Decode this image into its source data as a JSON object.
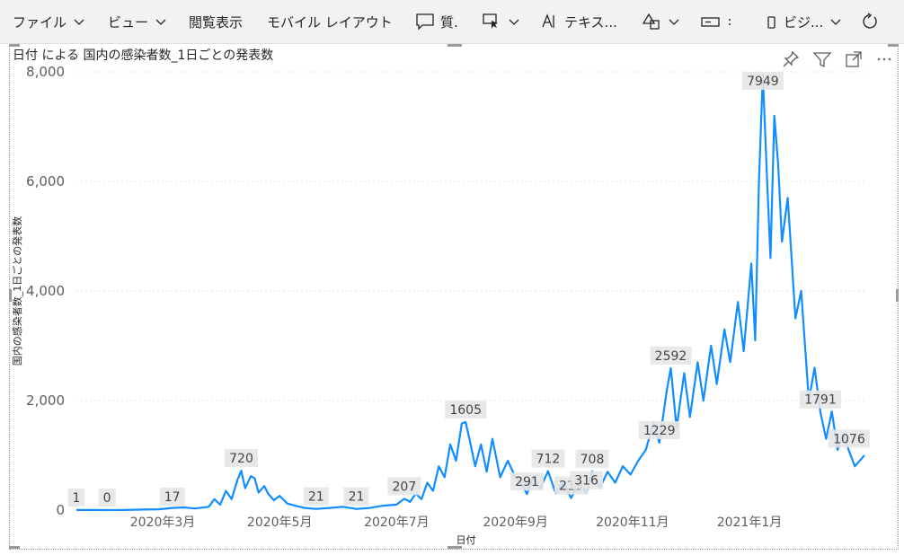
{
  "toolbar": {
    "file": "ファイル",
    "view": "ビュー",
    "reading_view": "閲覧表示",
    "mobile_layout": "モバイル レイアウト",
    "qa": "質.",
    "textbox": "テキス...",
    "visual": "ビジ..."
  },
  "chart_data": {
    "type": "line",
    "title": "日付 による 国内の感染者数_1日ごとの発表数",
    "xlabel": "日付",
    "ylabel": "国内の感染者数_1日ごとの発表数",
    "x_range": [
      "2020-01-16",
      "2021-03-02"
    ],
    "ylim": [
      0,
      8000
    ],
    "y_ticks": [
      {
        "value": 0,
        "label": "0"
      },
      {
        "value": 2000,
        "label": "2,000"
      },
      {
        "value": 4000,
        "label": "4,000"
      },
      {
        "value": 6000,
        "label": "6,000"
      },
      {
        "value": 8000,
        "label": "8,000"
      }
    ],
    "x_ticks": [
      {
        "date": "2020-03-01",
        "label": "2020年3月"
      },
      {
        "date": "2020-05-01",
        "label": "2020年5月"
      },
      {
        "date": "2020-07-01",
        "label": "2020年7月"
      },
      {
        "date": "2020-09-01",
        "label": "2020年9月"
      },
      {
        "date": "2020-11-01",
        "label": "2020年11月"
      },
      {
        "date": "2021-01-01",
        "label": "2021年1月"
      }
    ],
    "grid": true,
    "line_color": "#118dff",
    "series": [
      {
        "points": [
          [
            "2020-01-16",
            1
          ],
          [
            "2020-01-25",
            1
          ],
          [
            "2020-02-01",
            0
          ],
          [
            "2020-02-10",
            2
          ],
          [
            "2020-02-20",
            10
          ],
          [
            "2020-02-28",
            15
          ],
          [
            "2020-03-06",
            40
          ],
          [
            "2020-03-12",
            50
          ],
          [
            "2020-03-18",
            30
          ],
          [
            "2020-03-25",
            60
          ],
          [
            "2020-03-28",
            200
          ],
          [
            "2020-03-31",
            100
          ],
          [
            "2020-04-03",
            350
          ],
          [
            "2020-04-06",
            200
          ],
          [
            "2020-04-09",
            550
          ],
          [
            "2020-04-11",
            720
          ],
          [
            "2020-04-13",
            400
          ],
          [
            "2020-04-16",
            620
          ],
          [
            "2020-04-18",
            580
          ],
          [
            "2020-04-20",
            320
          ],
          [
            "2020-04-23",
            440
          ],
          [
            "2020-04-25",
            300
          ],
          [
            "2020-04-28",
            180
          ],
          [
            "2020-05-01",
            260
          ],
          [
            "2020-05-05",
            120
          ],
          [
            "2020-05-09",
            80
          ],
          [
            "2020-05-14",
            40
          ],
          [
            "2020-05-20",
            21
          ],
          [
            "2020-05-27",
            40
          ],
          [
            "2020-06-03",
            60
          ],
          [
            "2020-06-10",
            21
          ],
          [
            "2020-06-17",
            40
          ],
          [
            "2020-06-24",
            80
          ],
          [
            "2020-07-01",
            100
          ],
          [
            "2020-07-05",
            207
          ],
          [
            "2020-07-08",
            150
          ],
          [
            "2020-07-11",
            300
          ],
          [
            "2020-07-14",
            200
          ],
          [
            "2020-07-17",
            500
          ],
          [
            "2020-07-20",
            350
          ],
          [
            "2020-07-23",
            800
          ],
          [
            "2020-07-26",
            600
          ],
          [
            "2020-07-29",
            1200
          ],
          [
            "2020-08-01",
            900
          ],
          [
            "2020-08-04",
            1580
          ],
          [
            "2020-08-06",
            1605
          ],
          [
            "2020-08-08",
            1300
          ],
          [
            "2020-08-11",
            800
          ],
          [
            "2020-08-14",
            1200
          ],
          [
            "2020-08-17",
            700
          ],
          [
            "2020-08-20",
            1300
          ],
          [
            "2020-08-24",
            600
          ],
          [
            "2020-08-28",
            900
          ],
          [
            "2020-09-01",
            600
          ],
          [
            "2020-09-04",
            500
          ],
          [
            "2020-09-07",
            291
          ],
          [
            "2020-09-10",
            600
          ],
          [
            "2020-09-14",
            400
          ],
          [
            "2020-09-18",
            712
          ],
          [
            "2020-09-22",
            300
          ],
          [
            "2020-09-26",
            500
          ],
          [
            "2020-09-30",
            219
          ],
          [
            "2020-10-04",
            500
          ],
          [
            "2020-10-08",
            316
          ],
          [
            "2020-10-11",
            708
          ],
          [
            "2020-10-15",
            400
          ],
          [
            "2020-10-19",
            700
          ],
          [
            "2020-10-23",
            500
          ],
          [
            "2020-10-27",
            800
          ],
          [
            "2020-10-31",
            650
          ],
          [
            "2020-11-04",
            900
          ],
          [
            "2020-11-08",
            1100
          ],
          [
            "2020-11-12",
            1600
          ],
          [
            "2020-11-15",
            1229
          ],
          [
            "2020-11-19",
            2200
          ],
          [
            "2020-11-21",
            2592
          ],
          [
            "2020-11-24",
            1500
          ],
          [
            "2020-11-28",
            2500
          ],
          [
            "2020-12-01",
            1700
          ],
          [
            "2020-12-05",
            2700
          ],
          [
            "2020-12-08",
            2000
          ],
          [
            "2020-12-12",
            3000
          ],
          [
            "2020-12-15",
            2300
          ],
          [
            "2020-12-19",
            3300
          ],
          [
            "2020-12-22",
            2700
          ],
          [
            "2020-12-26",
            3800
          ],
          [
            "2020-12-29",
            2900
          ],
          [
            "2021-01-02",
            4500
          ],
          [
            "2021-01-04",
            3100
          ],
          [
            "2021-01-06",
            6000
          ],
          [
            "2021-01-08",
            7949
          ],
          [
            "2021-01-10",
            6200
          ],
          [
            "2021-01-12",
            4600
          ],
          [
            "2021-01-14",
            7200
          ],
          [
            "2021-01-16",
            6300
          ],
          [
            "2021-01-18",
            4900
          ],
          [
            "2021-01-21",
            5700
          ],
          [
            "2021-01-25",
            3500
          ],
          [
            "2021-01-28",
            4000
          ],
          [
            "2021-02-01",
            2000
          ],
          [
            "2021-02-04",
            2600
          ],
          [
            "2021-02-07",
            1791
          ],
          [
            "2021-02-10",
            1300
          ],
          [
            "2021-02-13",
            1800
          ],
          [
            "2021-02-16",
            1100
          ],
          [
            "2021-02-19",
            1400
          ],
          [
            "2021-02-22",
            1076
          ],
          [
            "2021-02-25",
            800
          ],
          [
            "2021-03-02",
            1000
          ]
        ]
      }
    ],
    "data_labels": [
      {
        "date": "2020-01-16",
        "value": 1,
        "label": "1"
      },
      {
        "date": "2020-02-01",
        "value": 0,
        "label": "0"
      },
      {
        "date": "2020-03-06",
        "value": 17,
        "label": "17"
      },
      {
        "date": "2020-04-11",
        "value": 720,
        "label": "720"
      },
      {
        "date": "2020-05-20",
        "value": 21,
        "label": "21"
      },
      {
        "date": "2020-06-10",
        "value": 21,
        "label": "21"
      },
      {
        "date": "2020-07-05",
        "value": 207,
        "label": "207"
      },
      {
        "date": "2020-08-06",
        "value": 1605,
        "label": "1605"
      },
      {
        "date": "2020-09-07",
        "value": 291,
        "label": "291"
      },
      {
        "date": "2020-09-18",
        "value": 712,
        "label": "712"
      },
      {
        "date": "2020-09-30",
        "value": 219,
        "label": "219"
      },
      {
        "date": "2020-10-08",
        "value": 316,
        "label": "316"
      },
      {
        "date": "2020-10-11",
        "value": 708,
        "label": "708"
      },
      {
        "date": "2020-11-15",
        "value": 1229,
        "label": "1229"
      },
      {
        "date": "2020-11-21",
        "value": 2592,
        "label": "2592"
      },
      {
        "date": "2021-01-08",
        "value": 7949,
        "label": "7949"
      },
      {
        "date": "2021-02-07",
        "value": 1791,
        "label": "1791"
      },
      {
        "date": "2021-02-22",
        "value": 1076,
        "label": "1076"
      }
    ]
  }
}
